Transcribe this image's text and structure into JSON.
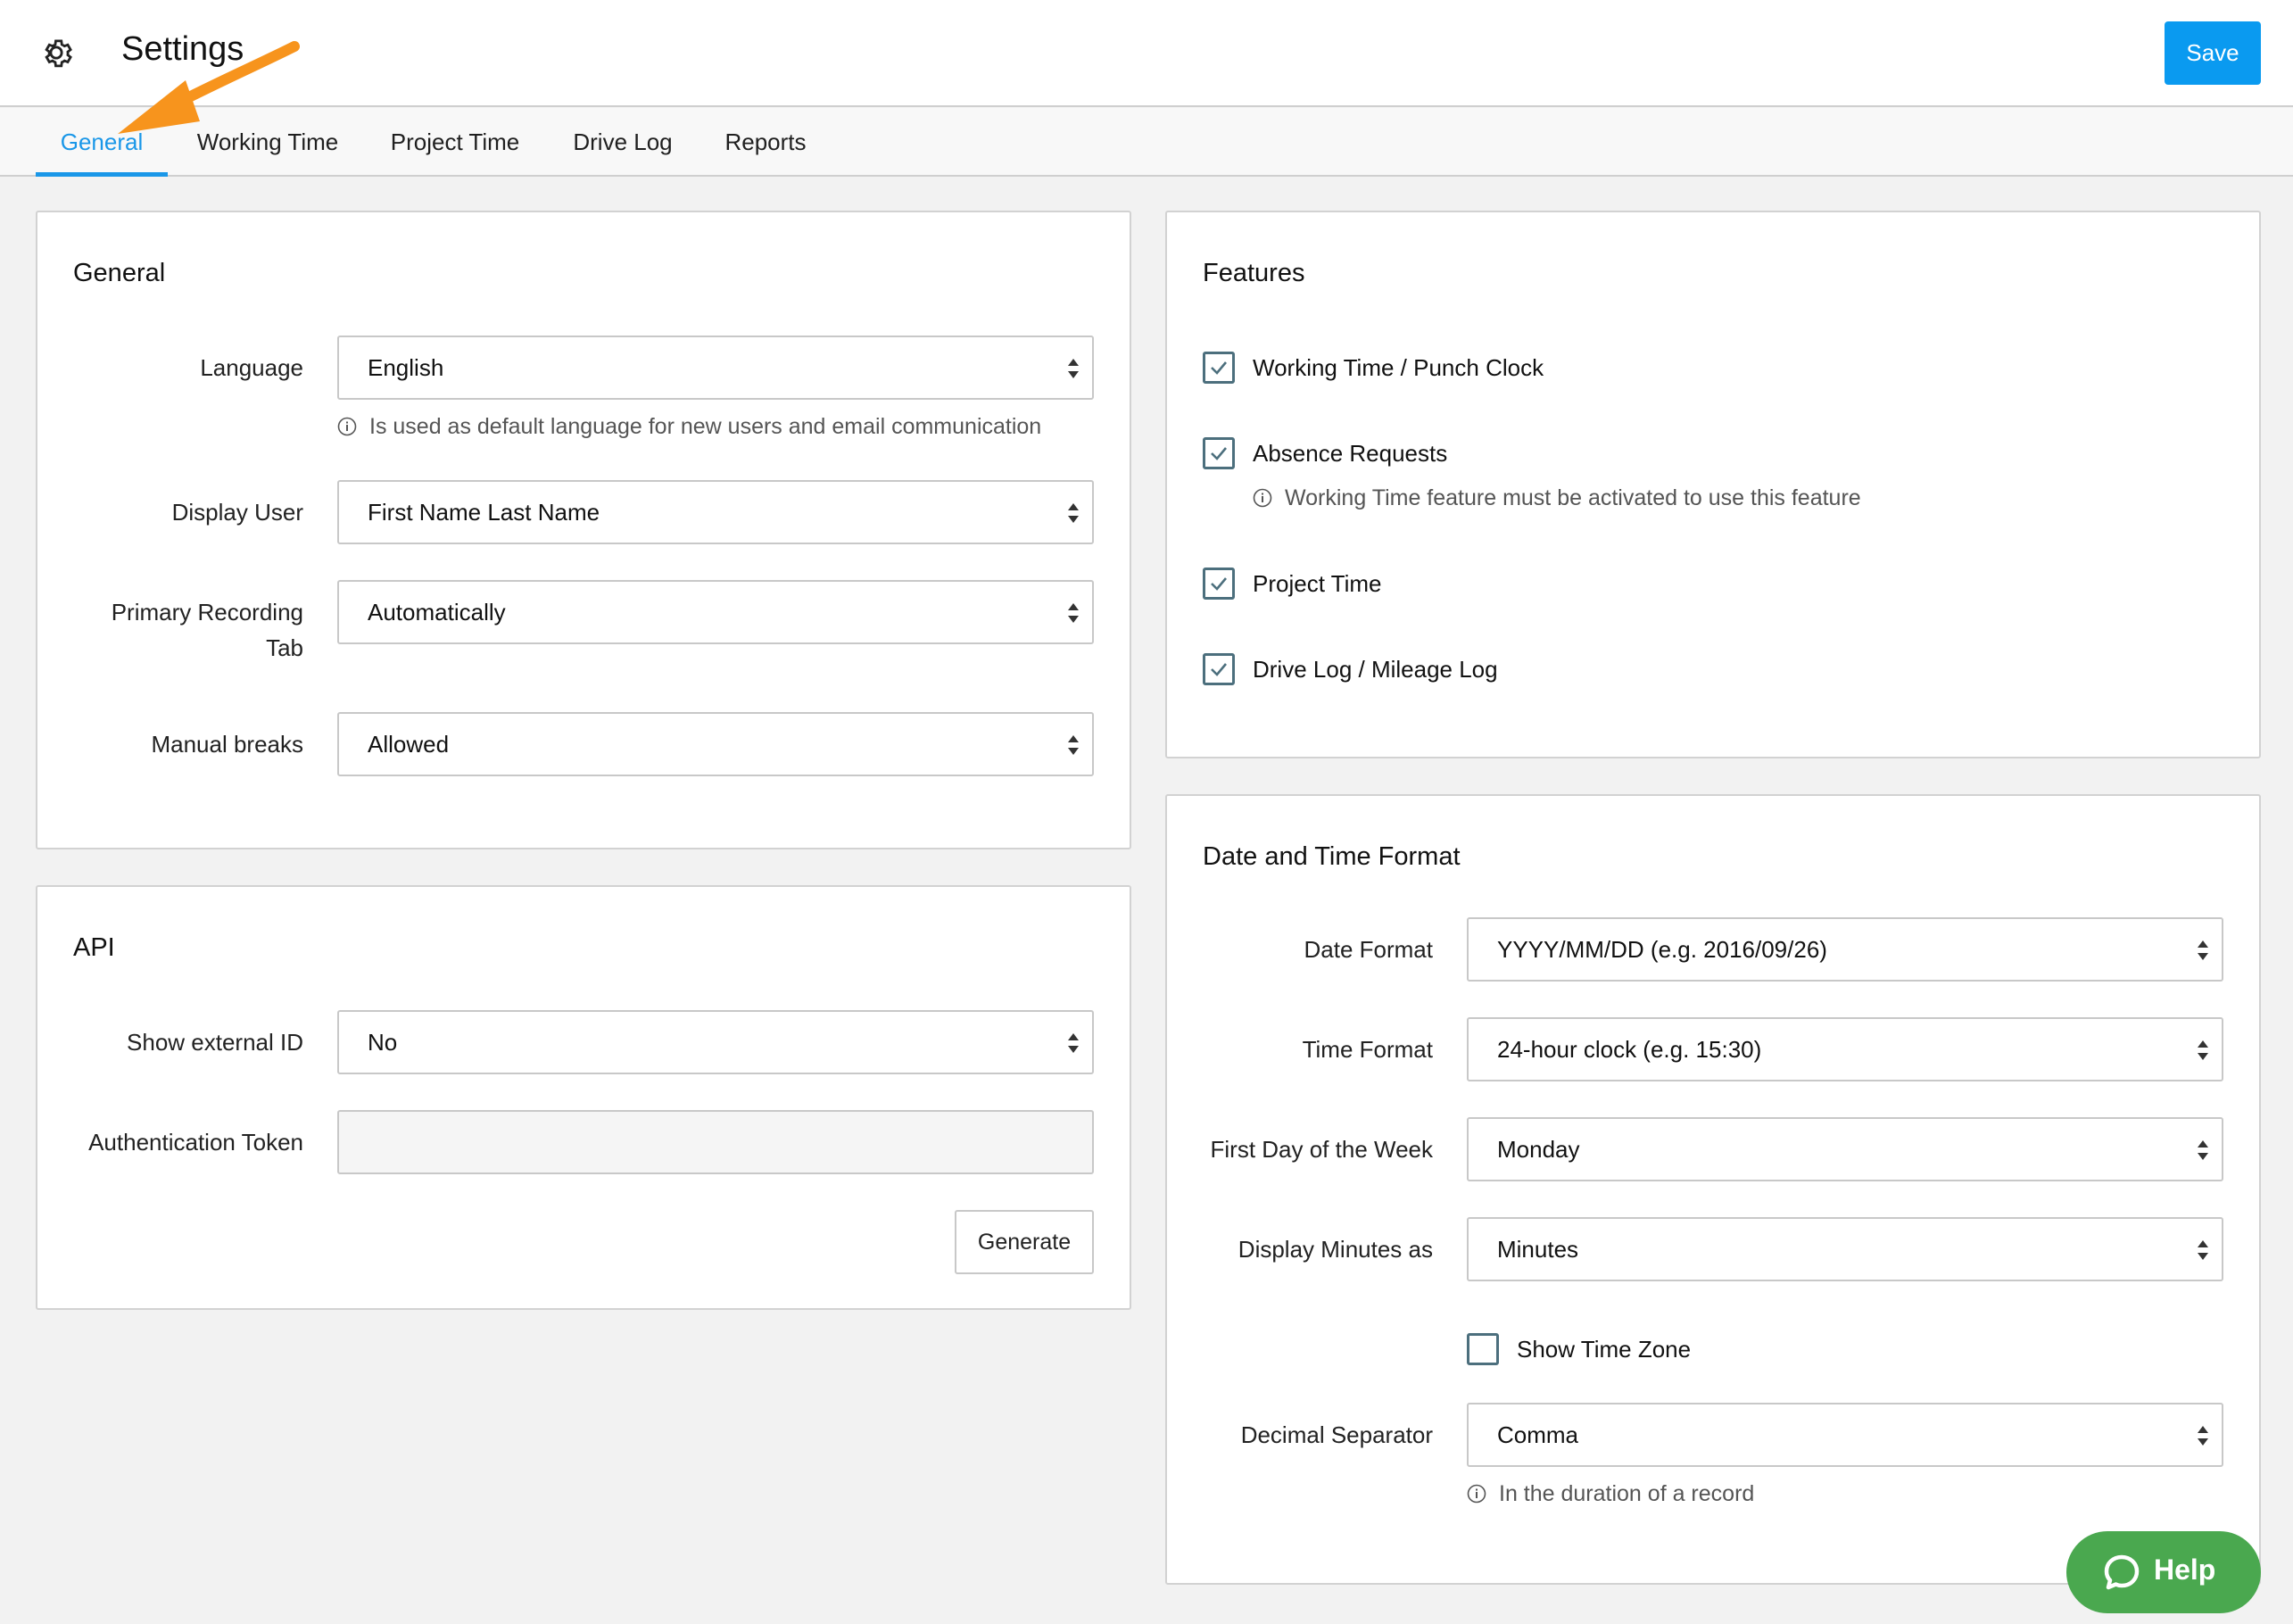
{
  "header": {
    "title": "Settings",
    "save_label": "Save",
    "icon": "gear-icon"
  },
  "tabs": [
    {
      "label": "General",
      "active": true
    },
    {
      "label": "Working Time"
    },
    {
      "label": "Project Time"
    },
    {
      "label": "Drive Log"
    },
    {
      "label": "Reports"
    }
  ],
  "general": {
    "title": "General",
    "language": {
      "label": "Language",
      "value": "English",
      "hint": "Is used as default language for new users and email communication"
    },
    "display_user": {
      "label": "Display User",
      "value": "First Name Last Name"
    },
    "primary_tab": {
      "label_line1": "Primary Recording",
      "label_line2": "Tab",
      "value": "Automatically"
    },
    "manual_breaks": {
      "label": "Manual breaks",
      "value": "Allowed"
    }
  },
  "api": {
    "title": "API",
    "external_id": {
      "label": "Show external ID",
      "value": "No"
    },
    "auth_token": {
      "label": "Authentication Token",
      "value": ""
    },
    "generate_label": "Generate"
  },
  "features": {
    "title": "Features",
    "items": [
      {
        "label": "Working Time / Punch Clock",
        "checked": true
      },
      {
        "label": "Absence Requests",
        "checked": true,
        "hint": "Working Time feature must be activated to use this feature"
      },
      {
        "label": "Project Time",
        "checked": true
      },
      {
        "label": "Drive Log / Mileage Log",
        "checked": true
      }
    ]
  },
  "datetime": {
    "title": "Date and Time Format",
    "date_format": {
      "label": "Date Format",
      "value": "YYYY/MM/DD (e.g. 2016/09/26)"
    },
    "time_format": {
      "label": "Time Format",
      "value": "24-hour clock (e.g. 15:30)"
    },
    "first_day": {
      "label": "First Day of the Week",
      "value": "Monday"
    },
    "minutes": {
      "label": "Display Minutes as",
      "value": "Minutes"
    },
    "show_tz": {
      "label": "Show Time Zone",
      "checked": false
    },
    "decimal": {
      "label": "Decimal Separator",
      "value": "Comma",
      "hint": "In the duration of a record"
    }
  },
  "help": {
    "label": "Help"
  },
  "colors": {
    "accent": "#1a97e8",
    "save": "#0a9af0",
    "help": "#4aa84f",
    "annotation": "#f7941d"
  }
}
